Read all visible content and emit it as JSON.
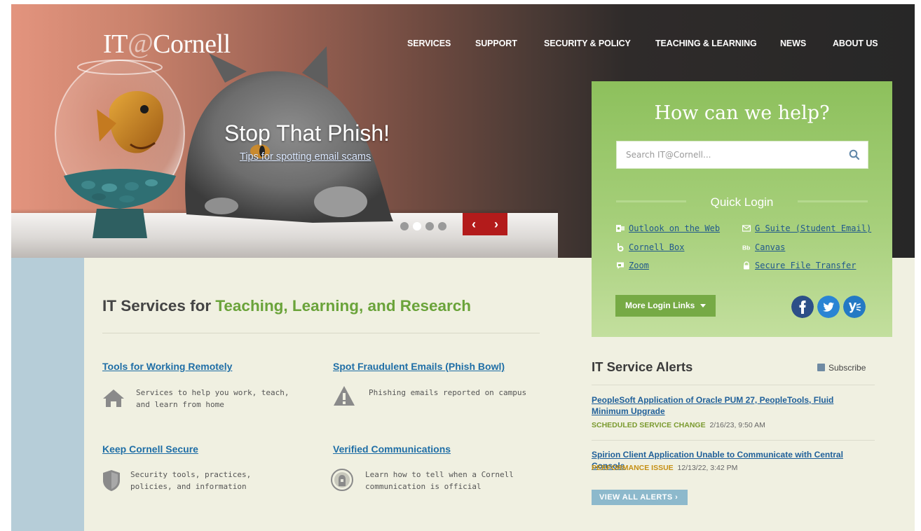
{
  "brand": {
    "logo_prefix": "IT",
    "logo_at": "@",
    "logo_suffix": "Cornell"
  },
  "nav": [
    {
      "label": "SERVICES"
    },
    {
      "label": "SUPPORT"
    },
    {
      "label": "SECURITY & POLICY"
    },
    {
      "label": "TEACHING & LEARNING"
    },
    {
      "label": "NEWS"
    },
    {
      "label": "ABOUT US"
    }
  ],
  "hero": {
    "title": "Stop That Phish!",
    "link": "Tips for spotting email scams",
    "slide_count": 4,
    "active_slide": 2,
    "prev_glyph": "‹",
    "next_glyph": "›"
  },
  "help": {
    "title": "How can we help?",
    "search_placeholder": "Search IT@Cornell...",
    "quick_login_title": "Quick Login",
    "quick_login": [
      {
        "label": "Outlook on the Web",
        "icon": "outlook-icon"
      },
      {
        "label": "G Suite (Student Email)",
        "icon": "envelope-icon"
      },
      {
        "label": "Cornell Box",
        "icon": "box-icon"
      },
      {
        "label": "Canvas",
        "icon": "canvas-icon"
      },
      {
        "label": "Zoom",
        "icon": "zoom-icon"
      },
      {
        "label": "Secure File Transfer",
        "icon": "lock-icon"
      }
    ],
    "more_login_label": "More Login Links",
    "social": [
      "facebook-icon",
      "twitter-icon",
      "yammer-icon"
    ]
  },
  "services": {
    "title_plain": "IT Services for ",
    "title_highlight": "Teaching, Learning, and Research",
    "items": [
      {
        "title": "Tools for Working Remotely",
        "desc": "Services to help you work, teach, and learn from home",
        "icon": "house-icon"
      },
      {
        "title": "Spot Fraudulent Emails (Phish Bowl)",
        "desc": "Phishing emails reported on campus",
        "icon": "warning-icon"
      },
      {
        "title": "Keep Cornell Secure",
        "desc": "Security tools, practices, policies, and information",
        "icon": "shield-icon"
      },
      {
        "title": "Verified Communications",
        "desc": "Learn how to tell when a Cornell communication is official",
        "icon": "verified-seal-icon"
      }
    ]
  },
  "alerts": {
    "title": "IT Service Alerts",
    "subscribe_label": "Subscribe",
    "items": [
      {
        "title": "PeopleSoft Application of Oracle PUM 27, PeopleTools, Fluid Minimum Upgrade",
        "kind": "SCHEDULED SERVICE CHANGE",
        "when": "2/16/23, 9:50 AM"
      },
      {
        "title": "Spirion Client Application Unable to Communicate with Central Console",
        "kind": "PERFORMANCE ISSUE",
        "when": "12/13/22, 3:42 PM"
      }
    ],
    "view_all_label": "VIEW ALL ALERTS",
    "view_all_glyph": "›"
  },
  "colors": {
    "accent_green": "#8dc05c",
    "title_green": "#6aa33a",
    "cornell_red": "#b31b1b",
    "link_blue": "#1f6ea6",
    "alert_scheduled": "#7a9a2f",
    "alert_performance": "#c58f14",
    "view_all_blue": "#8db9cc",
    "strip_blue": "#b6cdd8",
    "page_cream": "#f0f0e1"
  }
}
